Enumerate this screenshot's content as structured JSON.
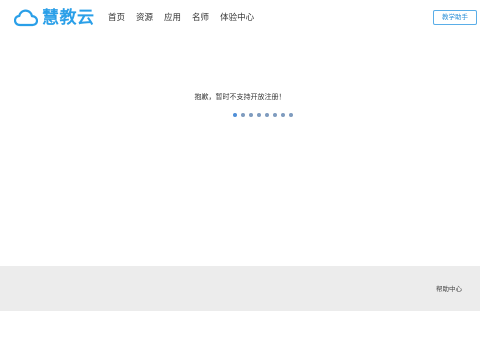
{
  "header": {
    "logo_text": "慧教云",
    "nav": [
      "首页",
      "资源",
      "应用",
      "名师",
      "体验中心"
    ],
    "assist_button": "教学助手"
  },
  "main": {
    "message": "抱歉，暂时不支持开放注册！",
    "loading_dots": 8
  },
  "footer": {
    "help_link": "帮助中心"
  },
  "colors": {
    "brand": "#2a9fe8",
    "footer_bg": "#ececec"
  }
}
